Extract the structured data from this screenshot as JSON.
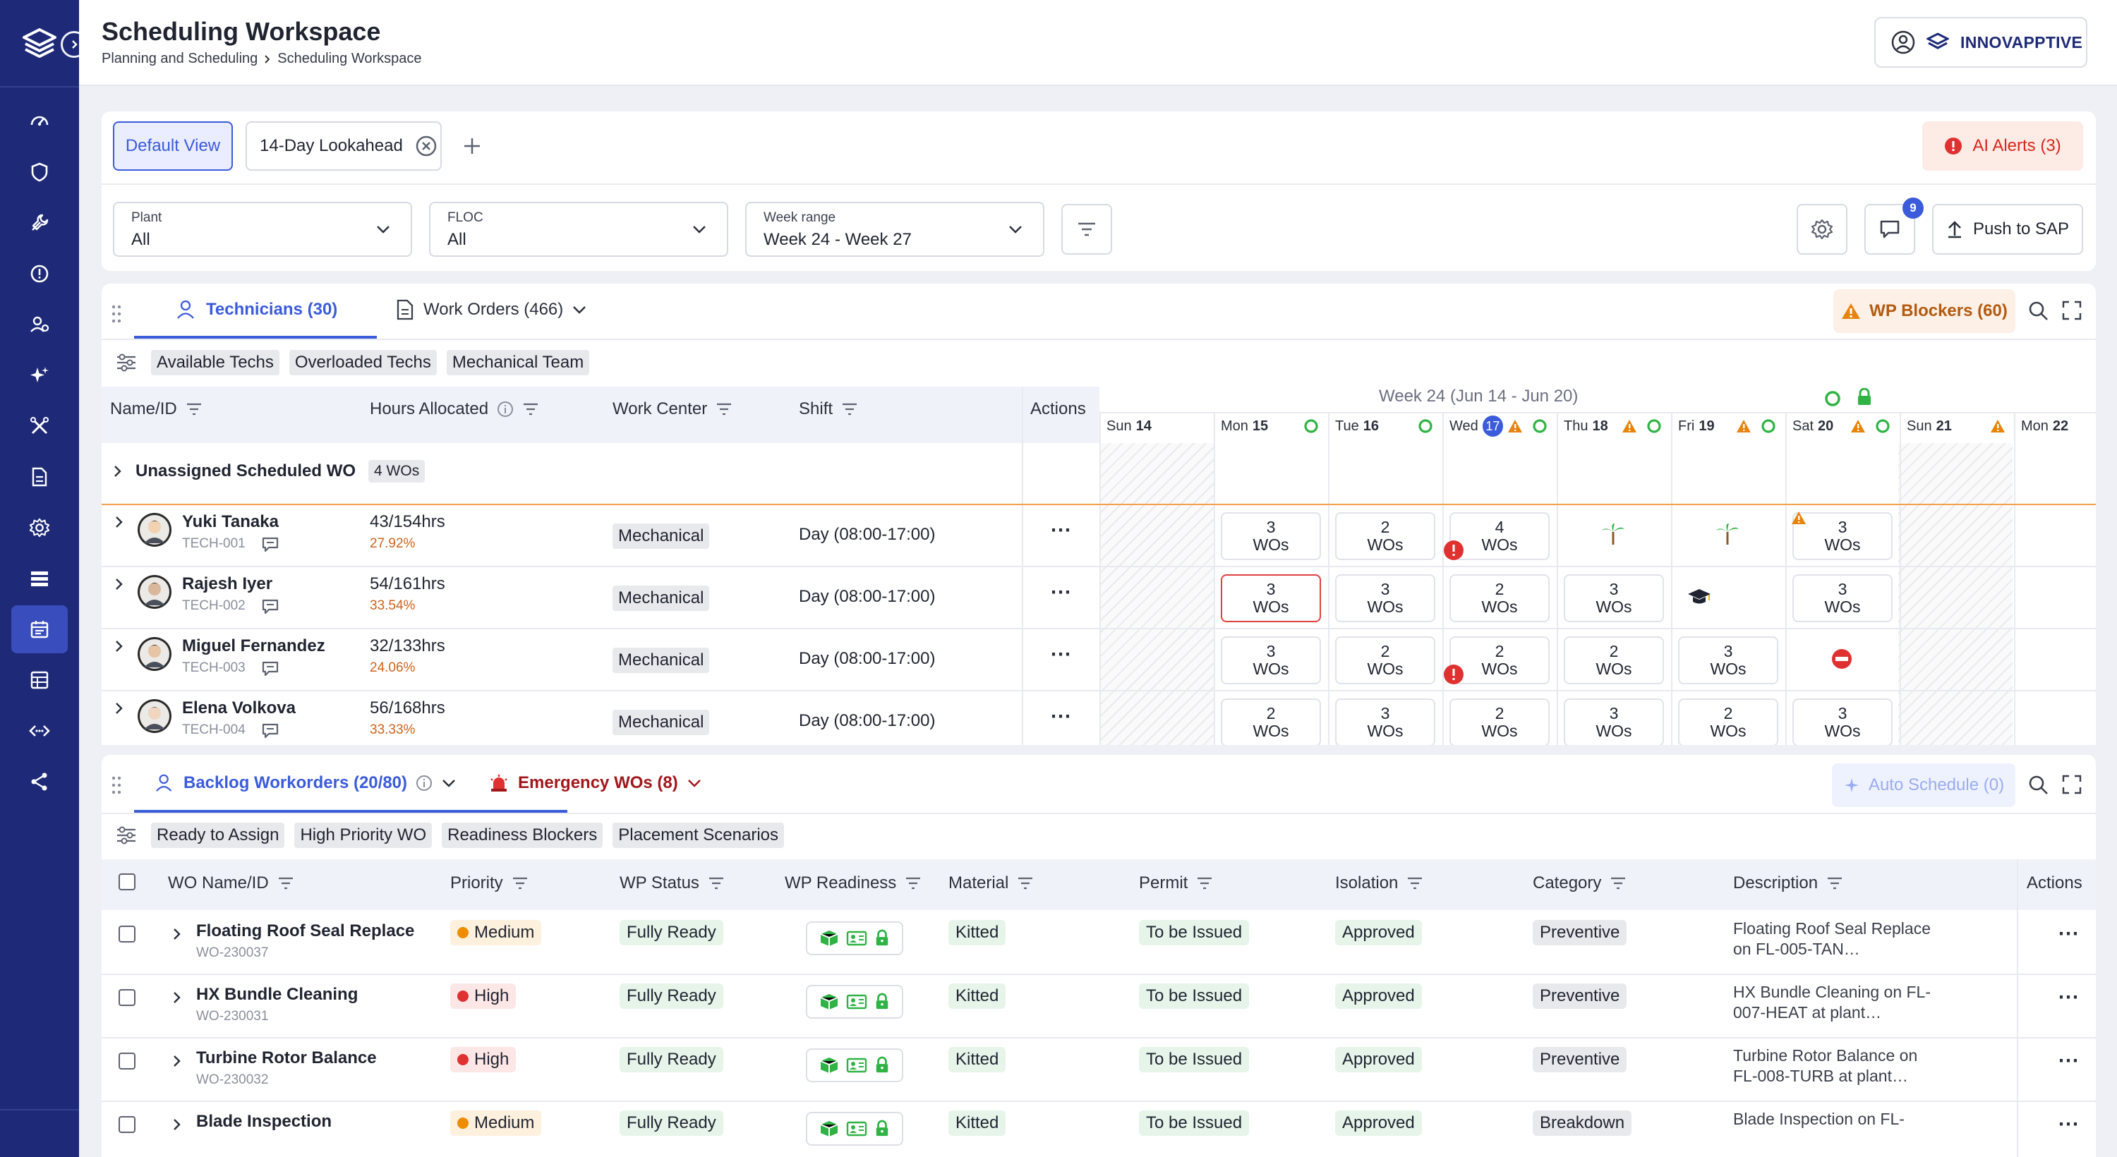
{
  "app": {
    "title": "Scheduling Workspace",
    "breadcrumb": [
      "Planning and Scheduling",
      "Scheduling Workspace"
    ],
    "brand": "INNOVAPPTIVE"
  },
  "colors": {
    "sidebar": "#1e2a78",
    "accent": "#3b5bdb",
    "danger": "#e03131",
    "warn": "#e8830c",
    "success": "#2fb344"
  },
  "sidebar": {
    "icons": [
      "dashboard-icon",
      "shield-icon",
      "tools-icon",
      "alert-icon",
      "users-icon",
      "sparkle-icon",
      "wrench-icon",
      "document-icon",
      "settings-icon",
      "list-icon",
      "calendar-icon",
      "table-icon",
      "code-icon",
      "share-icon"
    ],
    "active": "calendar-icon"
  },
  "views": {
    "tabs": [
      "Default View",
      "14-Day Lookahead"
    ],
    "active": "Default View"
  },
  "ai_alerts": "AI Alerts (3)",
  "filters": {
    "plant": {
      "label": "Plant",
      "value": "All"
    },
    "floc": {
      "label": "FLOC",
      "value": "All"
    },
    "week": {
      "label": "Week range",
      "value": "Week 24 - Week 27"
    }
  },
  "chat_badge": "9",
  "push_label": "Push to SAP",
  "tech_panel": {
    "tabs": [
      "Technicians (30)",
      "Work Orders (466)"
    ],
    "blockers": "WP Blockers (60)",
    "quick_filters": [
      "Available Techs",
      "Overloaded Techs",
      "Mechanical Team"
    ],
    "columns": [
      "Name/ID",
      "Hours Allocated",
      "Work Center",
      "Shift",
      "Actions"
    ],
    "week_label": "Week 24 (Jun 14 - Jun 20)",
    "days": [
      {
        "name": "Sun",
        "num": "14"
      },
      {
        "name": "Mon",
        "num": "15"
      },
      {
        "name": "Tue",
        "num": "16"
      },
      {
        "name": "Wed",
        "num": "17"
      },
      {
        "name": "Thu",
        "num": "18"
      },
      {
        "name": "Fri",
        "num": "19"
      },
      {
        "name": "Sat",
        "num": "20"
      },
      {
        "name": "Sun",
        "num": "21"
      },
      {
        "name": "Mon",
        "num": "22"
      }
    ],
    "unassigned": {
      "label": "Unassigned Scheduled WO",
      "count": "4 WOs"
    },
    "techs": [
      {
        "name": "Yuki Tanaka",
        "id": "TECH-001",
        "hours": "43/154hrs",
        "pct": "27.92%",
        "wc": "Mechanical",
        "shift": "Day (08:00-17:00)",
        "cells": [
          {
            "n": "3",
            "u": "WOs"
          },
          {
            "n": "2",
            "u": "WOs"
          },
          {
            "n": "4",
            "u": "WOs"
          },
          {
            "icon": "palm-icon"
          },
          {
            "icon": "palm-icon"
          },
          {
            "n": "3",
            "u": "WOs"
          }
        ]
      },
      {
        "name": "Rajesh Iyer",
        "id": "TECH-002",
        "hours": "54/161hrs",
        "pct": "33.54%",
        "wc": "Mechanical",
        "shift": "Day (08:00-17:00)",
        "cells": [
          {
            "n": "3",
            "u": "WOs"
          },
          {
            "n": "3",
            "u": "WOs"
          },
          {
            "n": "2",
            "u": "WOs"
          },
          {
            "n": "3",
            "u": "WOs"
          },
          {
            "icon": "graduation-cap-icon"
          },
          {
            "n": "3",
            "u": "WOs"
          }
        ]
      },
      {
        "name": "Miguel Fernandez",
        "id": "TECH-003",
        "hours": "32/133hrs",
        "pct": "24.06%",
        "wc": "Mechanical",
        "shift": "Day (08:00-17:00)",
        "cells": [
          {
            "n": "3",
            "u": "WOs"
          },
          {
            "n": "2",
            "u": "WOs"
          },
          {
            "n": "2",
            "u": "WOs"
          },
          {
            "n": "2",
            "u": "WOs"
          },
          {
            "n": "3",
            "u": "WOs"
          },
          {
            "icon": "blocked-icon"
          }
        ]
      },
      {
        "name": "Elena Volkova",
        "id": "TECH-004",
        "hours": "56/168hrs",
        "pct": "33.33%",
        "wc": "Mechanical",
        "shift": "Day (08:00-17:00)",
        "cells": [
          {
            "n": "2",
            "u": "WOs"
          },
          {
            "n": "3",
            "u": "WOs"
          },
          {
            "n": "2",
            "u": "WOs"
          },
          {
            "n": "3",
            "u": "WOs"
          },
          {
            "n": "2",
            "u": "WOs"
          },
          {
            "n": "3",
            "u": "WOs"
          }
        ]
      }
    ]
  },
  "backlog_panel": {
    "tabs": [
      "Backlog Workorders (20/80)",
      "Emergency WOs (8)"
    ],
    "auto_schedule": "Auto Schedule (0)",
    "quick_filters": [
      "Ready to Assign",
      "High Priority WO",
      "Readiness Blockers",
      "Placement Scenarios"
    ],
    "columns": [
      "WO Name/ID",
      "Priority",
      "WP Status",
      "WP Readiness",
      "Material",
      "Permit",
      "Isolation",
      "Category",
      "Description",
      "Actions"
    ],
    "rows": [
      {
        "name": "Floating Roof Seal Replace",
        "id": "WO-230037",
        "priority": "Medium",
        "status": "Fully Ready",
        "material": "Kitted",
        "permit": "To be Issued",
        "isolation": "Approved",
        "category": "Preventive",
        "description": "Floating Roof Seal Replace on FL-005-TAN…"
      },
      {
        "name": "HX Bundle Cleaning",
        "id": "WO-230031",
        "priority": "High",
        "status": "Fully Ready",
        "material": "Kitted",
        "permit": "To be Issued",
        "isolation": "Approved",
        "category": "Preventive",
        "description": "HX Bundle Cleaning on FL-007-HEAT at plant…"
      },
      {
        "name": "Turbine Rotor Balance",
        "id": "WO-230032",
        "priority": "High",
        "status": "Fully Ready",
        "material": "Kitted",
        "permit": "To be Issued",
        "isolation": "Approved",
        "category": "Preventive",
        "description": "Turbine Rotor Balance on FL-008-TURB at plant…"
      },
      {
        "name": "Blade Inspection",
        "id": "",
        "priority": "Medium",
        "status": "Fully Ready",
        "material": "Kitted",
        "permit": "To be Issued",
        "isolation": "Approved",
        "category": "Breakdown",
        "description": "Blade Inspection on FL-"
      }
    ]
  }
}
